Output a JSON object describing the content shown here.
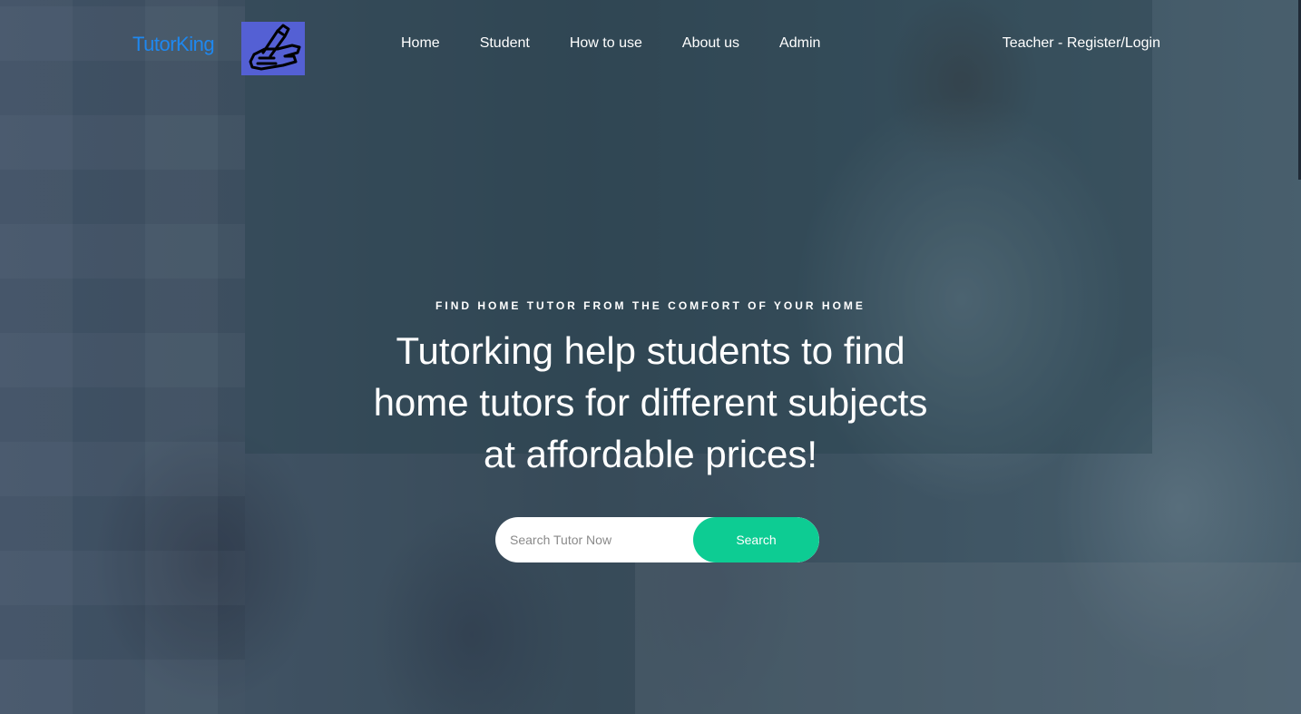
{
  "header": {
    "brand": "TutorKing",
    "nav": {
      "home": "Home",
      "student": "Student",
      "how_to_use": "How to use",
      "about_us": "About us",
      "admin": "Admin"
    },
    "teacher_link": "Teacher - Register/Login"
  },
  "hero": {
    "eyebrow": "FIND HOME TUTOR FROM THE COMFORT OF YOUR HOME",
    "headline": "Tutorking help students to find home tutors for different subjects at affordable prices!"
  },
  "search": {
    "placeholder": "Search Tutor Now",
    "value": "",
    "button_label": "Search"
  },
  "colors": {
    "brand": "#1e88f0",
    "logo_bg": "#5460d4",
    "search_button": "#0dcc93"
  },
  "icons": {
    "logo": "writing-hand-icon"
  }
}
